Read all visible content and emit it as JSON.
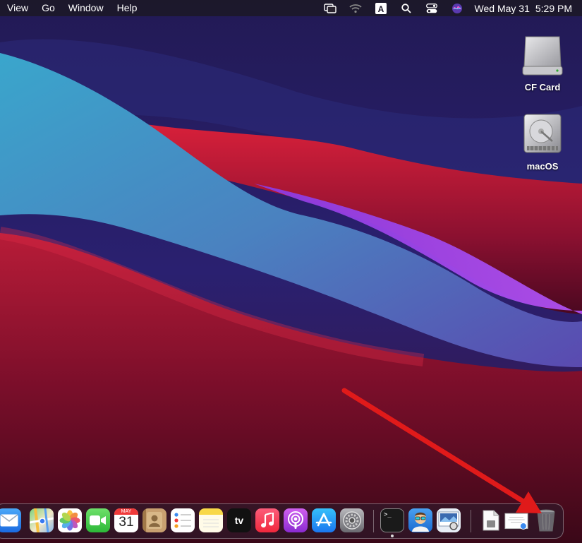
{
  "menubar": {
    "items": [
      "View",
      "Go",
      "Window",
      "Help"
    ],
    "clock": {
      "date": "Wed May 31",
      "time": "5:29 PM"
    },
    "status_icons": [
      "screen-mirroring-icon",
      "wifi-icon",
      "input-source-icon",
      "spotlight-search-icon",
      "control-center-icon",
      "siri-icon"
    ],
    "input_source_letter": "A"
  },
  "desktop": {
    "icons": [
      {
        "label": "CF Card",
        "icon": "external-drive-icon"
      },
      {
        "label": "macOS",
        "icon": "hard-drive-icon"
      }
    ]
  },
  "dock": {
    "apps": [
      {
        "name": "Mail",
        "icon": "mail-icon"
      },
      {
        "name": "Maps",
        "icon": "maps-icon"
      },
      {
        "name": "Photos",
        "icon": "photos-icon"
      },
      {
        "name": "FaceTime",
        "icon": "facetime-icon"
      },
      {
        "name": "Calendar",
        "icon": "calendar-icon",
        "month": "MAY",
        "day": "31"
      },
      {
        "name": "Contacts",
        "icon": "contacts-icon"
      },
      {
        "name": "Reminders",
        "icon": "reminders-icon"
      },
      {
        "name": "Notes",
        "icon": "notes-icon"
      },
      {
        "name": "TV",
        "icon": "apple-tv-icon",
        "label": "tv"
      },
      {
        "name": "Music",
        "icon": "music-icon"
      },
      {
        "name": "Podcasts",
        "icon": "podcasts-icon"
      },
      {
        "name": "App Store",
        "icon": "app-store-icon"
      },
      {
        "name": "System Preferences",
        "icon": "system-preferences-icon"
      },
      {
        "name": "Terminal",
        "icon": "terminal-icon",
        "prompt": ">_"
      },
      {
        "name": "Doctor App",
        "icon": "doctor-app-icon"
      },
      {
        "name": "Preview",
        "icon": "preview-icon"
      },
      {
        "name": "Document",
        "icon": "document-icon"
      },
      {
        "name": "Certificate",
        "icon": "certificate-icon"
      },
      {
        "name": "Trash",
        "icon": "trash-icon"
      }
    ]
  },
  "colors": {
    "arrow": "#e01a1a",
    "menubar_bg": "#1c1828",
    "wall_dark": "#1a1540",
    "wall_teal": "#3aa0c8",
    "wall_red": "#c81e3a",
    "wall_purple": "#a040e0"
  }
}
